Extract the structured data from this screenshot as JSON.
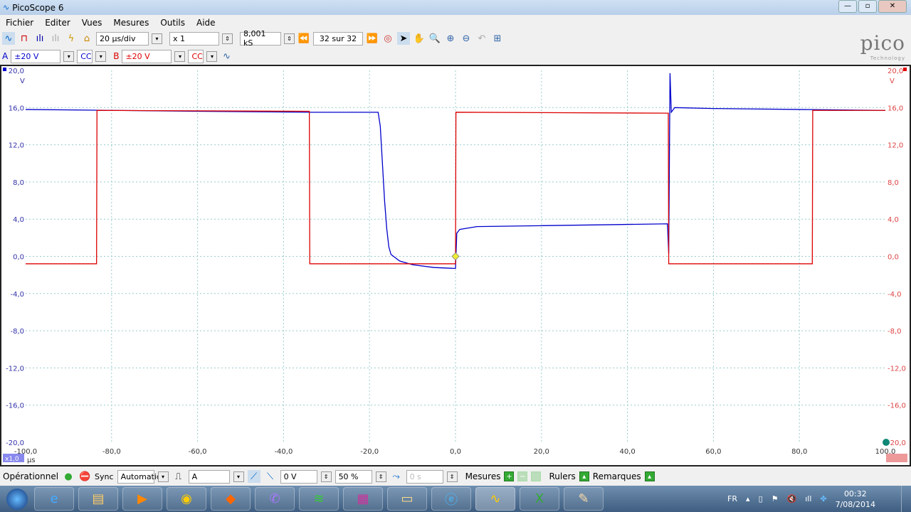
{
  "window": {
    "title": "PicoScope 6"
  },
  "menu": [
    "Fichier",
    "Editer",
    "Vues",
    "Mesures",
    "Outils",
    "Aide"
  ],
  "toolbar": {
    "timebase": "20 µs/div",
    "zoom": "x 1",
    "samples": "8,001 kS",
    "buffer": "32 sur 32"
  },
  "channels": {
    "a": {
      "label": "A",
      "range": "±20 V",
      "coupling": "CC",
      "color": "#0000cc"
    },
    "b": {
      "label": "B",
      "range": "±20 V",
      "coupling": "CC",
      "color": "#dd0000"
    }
  },
  "logo": {
    "text": "pico",
    "sub": "Technology"
  },
  "status": {
    "mode": "Opérationnel",
    "sync_label": "Sync",
    "sync_value": "Automatiq",
    "source": "A",
    "level": "0 V",
    "pretrigger": "50 %",
    "delay": "0 s",
    "measures": "Mesures",
    "rulers": "Rulers",
    "notes": "Remarques"
  },
  "taskbar": {
    "lang": "FR",
    "time": "00:32",
    "date": "7/08/2014"
  },
  "chart_data": {
    "type": "line",
    "xlabel": "µs",
    "xscale_badge": "x1,0",
    "yunit": "V",
    "xlim": [
      -100,
      100
    ],
    "ylim": [
      -20,
      20
    ],
    "xticks": [
      "-100,0",
      "-80,0",
      "-60,0",
      "-40,0",
      "-20,0",
      "0,0",
      "20,0",
      "40,0",
      "60,0",
      "80,0",
      "100,0"
    ],
    "yticks": [
      "20,0",
      "16,0",
      "12,0",
      "8,0",
      "4,0",
      "0,0",
      "-4,0",
      "-8,0",
      "-12,0",
      "-16,0",
      "-20,0"
    ],
    "grid": true,
    "series": [
      {
        "name": "A",
        "color": "#0000cc",
        "points": [
          [
            -100,
            15.8
          ],
          [
            -60,
            15.6
          ],
          [
            -34,
            15.5
          ],
          [
            -18,
            15.5
          ],
          [
            -17.5,
            14
          ],
          [
            -17,
            10
          ],
          [
            -16.5,
            6
          ],
          [
            -16,
            3
          ],
          [
            -15.5,
            1
          ],
          [
            -15,
            0.2
          ],
          [
            -13,
            -0.5
          ],
          [
            -10,
            -0.9
          ],
          [
            -5,
            -1.2
          ],
          [
            0,
            -1.3
          ],
          [
            0.3,
            2.5
          ],
          [
            1,
            2.9
          ],
          [
            5,
            3.2
          ],
          [
            20,
            3.3
          ],
          [
            35,
            3.4
          ],
          [
            49.3,
            3.5
          ],
          [
            49.6,
            0.3
          ],
          [
            49.9,
            19.7
          ],
          [
            50.2,
            15.5
          ],
          [
            51,
            16.0
          ],
          [
            60,
            15.9
          ],
          [
            80,
            15.8
          ],
          [
            100,
            15.7
          ]
        ]
      },
      {
        "name": "B",
        "color": "#dd0000",
        "points": [
          [
            -100,
            -0.8
          ],
          [
            -83.5,
            -0.8
          ],
          [
            -83.4,
            15.7
          ],
          [
            -34,
            15.6
          ],
          [
            -33.9,
            -0.8
          ],
          [
            0,
            -0.8
          ],
          [
            0.1,
            15.5
          ],
          [
            49.5,
            15.4
          ],
          [
            49.6,
            -0.8
          ],
          [
            83,
            -0.8
          ],
          [
            83.1,
            15.7
          ],
          [
            100,
            15.7
          ]
        ]
      }
    ],
    "trigger": {
      "x": 0,
      "y": 0
    }
  }
}
